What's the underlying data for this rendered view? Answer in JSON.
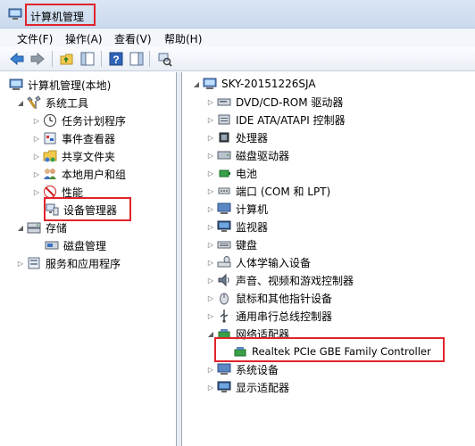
{
  "window": {
    "title": "计算机管理"
  },
  "menu": [
    "文件(F)",
    "操作(A)",
    "查看(V)",
    "帮助(H)"
  ],
  "left_tree": {
    "root": "计算机管理(本地)",
    "system_tools": "系统工具",
    "system_children": [
      "任务计划程序",
      "事件查看器",
      "共享文件夹",
      "本地用户和组",
      "性能",
      "设备管理器"
    ],
    "storage": "存储",
    "storage_children": [
      "磁盘管理"
    ],
    "services": "服务和应用程序"
  },
  "right_tree": {
    "root": "SKY-20151226SJA",
    "categories": [
      "DVD/CD-ROM 驱动器",
      "IDE ATA/ATAPI 控制器",
      "处理器",
      "磁盘驱动器",
      "电池",
      "端口 (COM 和 LPT)",
      "计算机",
      "监视器",
      "键盘",
      "人体学输入设备",
      "声音、视频和游戏控制器",
      "鼠标和其他指针设备",
      "通用串行总线控制器",
      "网络适配器"
    ],
    "network_child": "Realtek PCIe GBE Family Controller",
    "categories_after": [
      "系统设备",
      "显示适配器"
    ]
  },
  "colors": {
    "highlight": "#e0242b",
    "title_bg": "#d6e3f2"
  }
}
